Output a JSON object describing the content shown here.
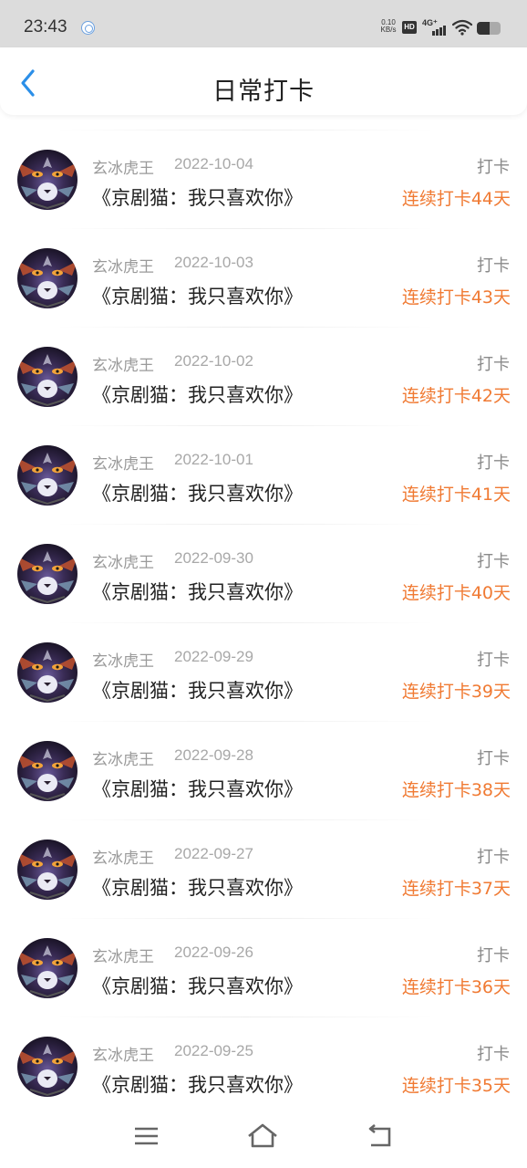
{
  "status_bar": {
    "time": "23:43",
    "net_speed_value": "0.10",
    "net_speed_unit": "KB/s",
    "hd_label": "HD",
    "network_type": "4G⁺",
    "battery_level": 0.55
  },
  "header": {
    "title": "日常打卡",
    "back_icon": "chevron-left-icon",
    "accent_color": "#2b8fe8"
  },
  "records": [
    {
      "user": "玄冰虎王",
      "date": "2022-10-04",
      "type": "打卡",
      "title": "《京剧猫：我只喜欢你》",
      "streak": "连续打卡44天"
    },
    {
      "user": "玄冰虎王",
      "date": "2022-10-03",
      "type": "打卡",
      "title": "《京剧猫：我只喜欢你》",
      "streak": "连续打卡43天"
    },
    {
      "user": "玄冰虎王",
      "date": "2022-10-02",
      "type": "打卡",
      "title": "《京剧猫：我只喜欢你》",
      "streak": "连续打卡42天"
    },
    {
      "user": "玄冰虎王",
      "date": "2022-10-01",
      "type": "打卡",
      "title": "《京剧猫：我只喜欢你》",
      "streak": "连续打卡41天"
    },
    {
      "user": "玄冰虎王",
      "date": "2022-09-30",
      "type": "打卡",
      "title": "《京剧猫：我只喜欢你》",
      "streak": "连续打卡40天"
    },
    {
      "user": "玄冰虎王",
      "date": "2022-09-29",
      "type": "打卡",
      "title": "《京剧猫：我只喜欢你》",
      "streak": "连续打卡39天"
    },
    {
      "user": "玄冰虎王",
      "date": "2022-09-28",
      "type": "打卡",
      "title": "《京剧猫：我只喜欢你》",
      "streak": "连续打卡38天"
    },
    {
      "user": "玄冰虎王",
      "date": "2022-09-27",
      "type": "打卡",
      "title": "《京剧猫：我只喜欢你》",
      "streak": "连续打卡37天"
    },
    {
      "user": "玄冰虎王",
      "date": "2022-09-26",
      "type": "打卡",
      "title": "《京剧猫：我只喜欢你》",
      "streak": "连续打卡36天"
    },
    {
      "user": "玄冰虎王",
      "date": "2022-09-25",
      "type": "打卡",
      "title": "《京剧猫：我只喜欢你》",
      "streak": "连续打卡35天"
    }
  ],
  "colors": {
    "streak": "#f07a33",
    "muted_text": "#9a9a9a",
    "status_bar_bg": "#dcdcdc"
  },
  "nav_bar": {
    "icons": [
      "menu-icon",
      "home-icon",
      "back-icon"
    ]
  }
}
